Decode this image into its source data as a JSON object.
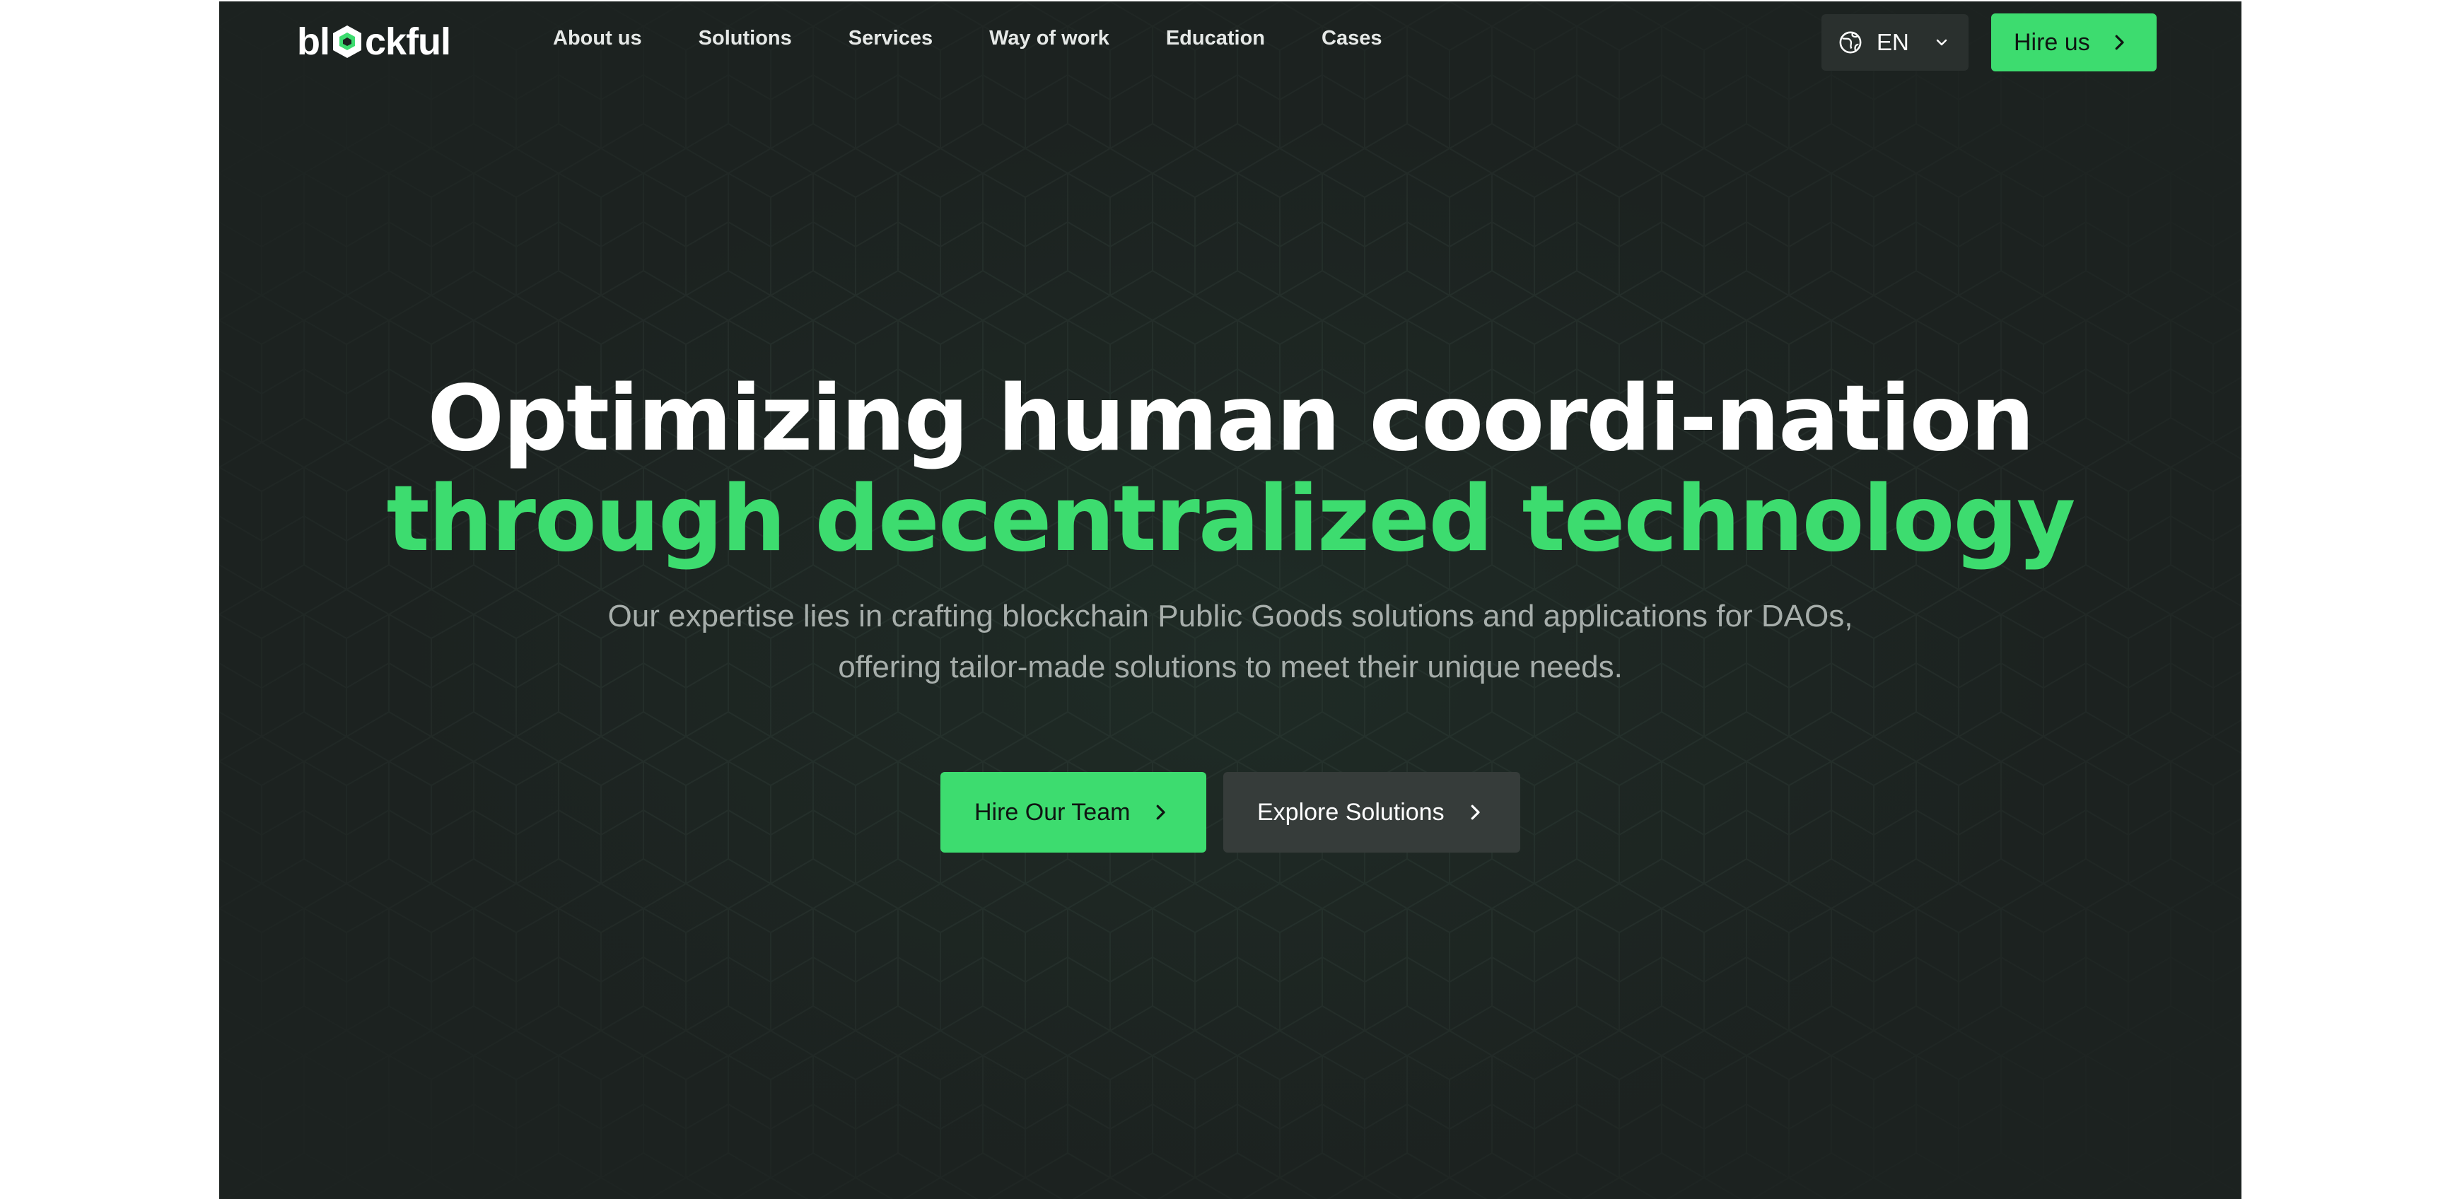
{
  "brand": {
    "logo_text_left": "bl",
    "logo_text_right": "ckful",
    "accent_color": "#3ddc6f",
    "background_color": "#1c2220"
  },
  "nav": {
    "items": [
      {
        "label": "About us"
      },
      {
        "label": "Solutions"
      },
      {
        "label": "Services"
      },
      {
        "label": "Way of work"
      },
      {
        "label": "Education"
      },
      {
        "label": "Cases"
      }
    ],
    "language": {
      "label": "EN",
      "icon": "globe-icon"
    },
    "hire_button": {
      "label": "Hire us",
      "icon": "chevron-right-icon"
    }
  },
  "hero": {
    "headline_line1": "Optimizing human coordi-nation",
    "headline_line2": "through decentralized technology",
    "subtitle_line1": "Our expertise lies in crafting blockchain Public Goods solutions and applications for DAOs,",
    "subtitle_line2": "offering tailor-made solutions to meet their unique needs.",
    "primary_cta": "Hire Our Team",
    "secondary_cta": "Explore Solutions"
  }
}
